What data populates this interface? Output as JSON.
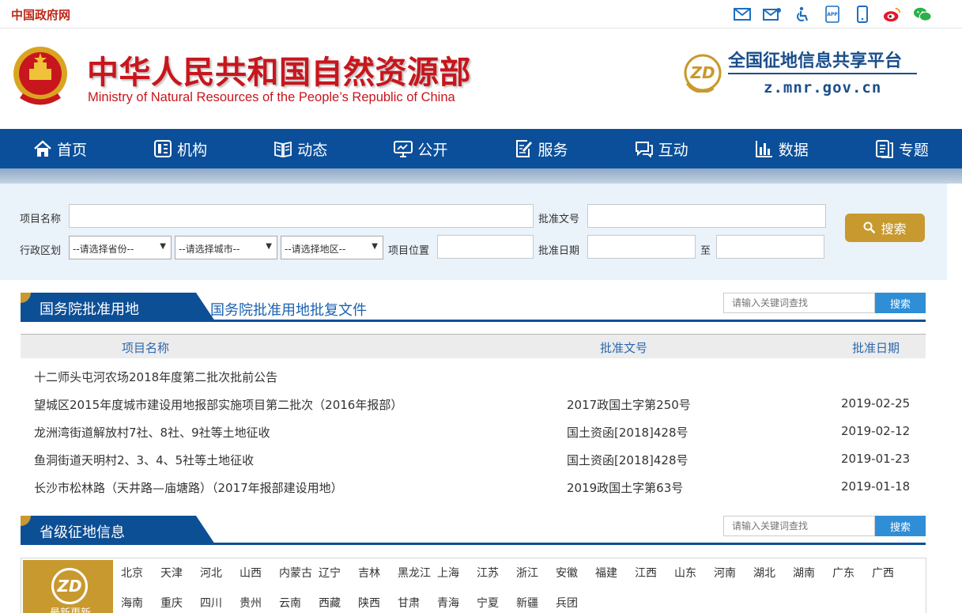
{
  "topbar": {
    "site": "中国政府网"
  },
  "header": {
    "title_cn": "中华人民共和国自然资源部",
    "title_en": "Ministry of Natural Resources of the People’s Republic of China",
    "logo_text": "ZD",
    "platform_title": "全国征地信息共享平台",
    "platform_url": "z.mnr.gov.cn"
  },
  "nav": [
    {
      "label": "首页",
      "icon": "home-icon"
    },
    {
      "label": "机构",
      "icon": "org-icon"
    },
    {
      "label": "动态",
      "icon": "book-icon"
    },
    {
      "label": "公开",
      "icon": "monitor-icon"
    },
    {
      "label": "服务",
      "icon": "edit-doc-icon"
    },
    {
      "label": "互动",
      "icon": "chat-icon"
    },
    {
      "label": "数据",
      "icon": "bar-chart-icon"
    },
    {
      "label": "专题",
      "icon": "files-icon"
    }
  ],
  "search": {
    "project_name_label": "项目名称",
    "approval_no_label": "批准文号",
    "region_label": "行政区划",
    "province_placeholder": "--请选择省份--",
    "city_placeholder": "--请选择城市--",
    "district_placeholder": "--请选择地区--",
    "location_label": "项目位置",
    "date_label": "批准日期",
    "to_label": "至",
    "button_label": "搜索"
  },
  "section1": {
    "tab": "国务院批准用地",
    "subtitle": "国务院批准用地批复文件",
    "keyword_placeholder": "请输入关键词查找",
    "keyword_button": "搜索",
    "columns": [
      "项目名称",
      "批准文号",
      "批准日期"
    ],
    "rows": [
      {
        "name": "十二师头屯河农场2018年度第二批次批前公告",
        "number": "",
        "date": ""
      },
      {
        "name": "望城区2015年度城市建设用地报部实施项目第二批次（2016年报部）",
        "number": "2017政国土字第250号",
        "date": "2019-02-25"
      },
      {
        "name": "龙洲湾街道解放村7社、8社、9社等土地征收",
        "number": "国土资函[2018]428号",
        "date": "2019-02-12"
      },
      {
        "name": "鱼洞街道天明村2、3、4、5社等土地征收",
        "number": "国土资函[2018]428号",
        "date": "2019-01-23"
      },
      {
        "name": "长沙市松林路（天井路—庙塘路）（2017年报部建设用地）",
        "number": "2019政国土字第63号",
        "date": "2019-01-18"
      }
    ]
  },
  "section2": {
    "tab": "省级征地信息",
    "keyword_placeholder": "请输入关键词查找",
    "keyword_button": "搜索",
    "latest_label": "最新更新",
    "latest_logo": "ZD",
    "provinces": [
      "北京",
      "天津",
      "河北",
      "山西",
      "内蒙古",
      "辽宁",
      "吉林",
      "黑龙江",
      "上海",
      "江苏",
      "浙江",
      "安徽",
      "福建",
      "江西",
      "山东",
      "河南",
      "湖北",
      "湖南",
      "广东",
      "广西",
      "海南",
      "重庆",
      "四川",
      "贵州",
      "云南",
      "西藏",
      "陕西",
      "甘肃",
      "青海",
      "宁夏",
      "新疆",
      "兵团"
    ]
  },
  "colors": {
    "nav_blue": "#0b4f9a",
    "gold": "#c8992e",
    "red_title": "#c8161d",
    "link_blue": "#1a62b1"
  }
}
